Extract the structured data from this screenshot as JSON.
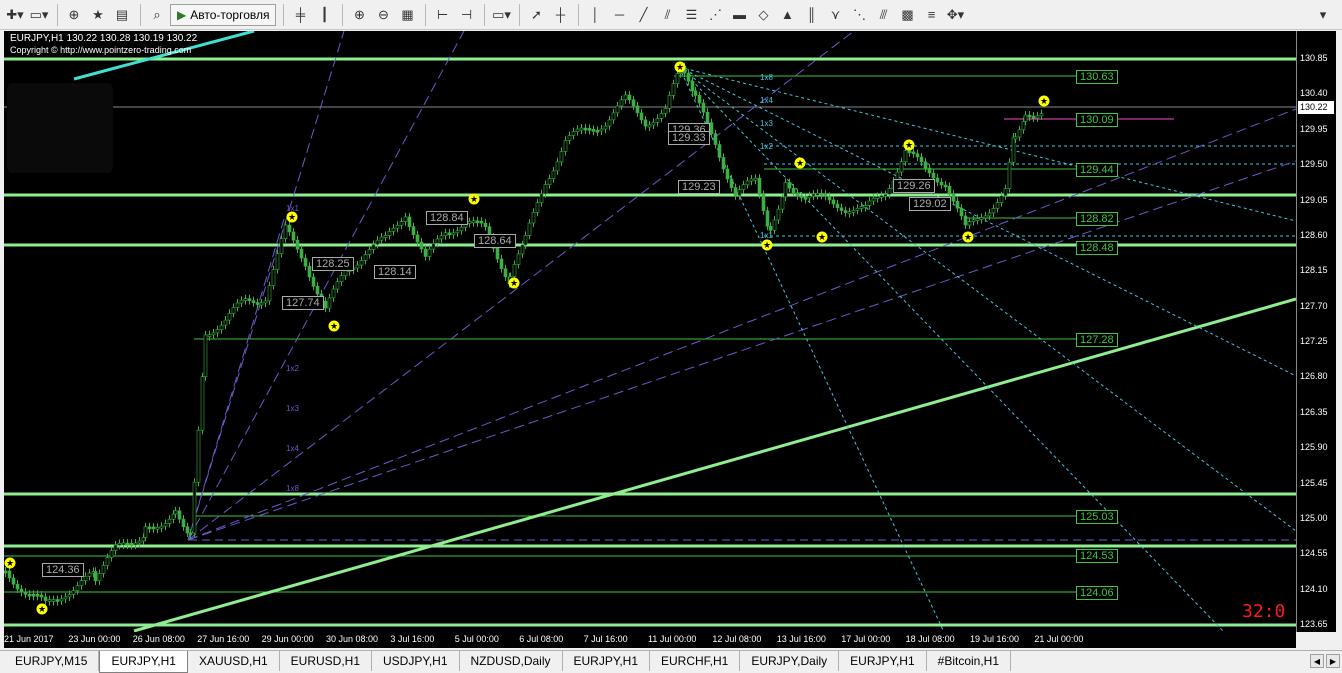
{
  "toolbar": {
    "autotrade_label": "Авто-торговля",
    "icons": [
      "new-chart-icon",
      "profiles-icon",
      "market-watch-icon",
      "navigator-icon",
      "terminal-icon",
      "strategy-tester-icon",
      "autotrade-icon",
      "bar-chart-icon",
      "candles-icon",
      "line-chart-icon",
      "zoom-in-icon",
      "zoom-out-icon",
      "tile-windows-icon",
      "chart-shift-icon",
      "autoscroll-icon",
      "period-icon",
      "cursor-icon",
      "crosshair-icon",
      "vertical-line-icon",
      "horizontal-line-icon",
      "trendline-icon",
      "equidistant-channel-icon",
      "fibonacci-icon",
      "fibonacci-fan-icon",
      "rectangle-icon",
      "gann-fan-icon",
      "triangle-icon",
      "fibonacci-timezones-icon",
      "andrews-pitchfork-icon",
      "gann-grid-icon",
      "channel-icon",
      "gann-line-icon",
      "arrows-icon"
    ]
  },
  "chart": {
    "symbol_line": "EURJPY,H1  130.22 130.28 130.19 130.22",
    "copyright": "Copyright © http://www.pointzero-trading.com",
    "countdown": "32:0",
    "current_price": "130.22",
    "price_labels": [
      "130.85",
      "130.40",
      "129.95",
      "129.50",
      "129.05",
      "128.60",
      "128.15",
      "127.70",
      "127.25",
      "126.80",
      "126.35",
      "125.90",
      "125.45",
      "125.00",
      "124.55",
      "124.10",
      "123.65"
    ],
    "time_labels": [
      "21 Jun 2017",
      "23 Jun 00:00",
      "26 Jun 08:00",
      "27 Jun 16:00",
      "29 Jun 00:00",
      "30 Jun 08:00",
      "3 Jul 16:00",
      "5 Jul 00:00",
      "6 Jul 08:00",
      "7 Jul 16:00",
      "11 Jul 00:00",
      "12 Jul 08:00",
      "13 Jul 16:00",
      "17 Jul 00:00",
      "18 Jul 08:00",
      "19 Jul 16:00",
      "21 Jul 00:00"
    ],
    "green_levels": [
      "130.63",
      "130.09",
      "129.44",
      "128.82",
      "128.48",
      "127.28",
      "125.03",
      "124.53",
      "124.06"
    ],
    "white_labels": [
      "124.36",
      "127.74",
      "128.25",
      "128.14",
      "128.84",
      "128.64",
      "129.23",
      "129.36",
      "129.33",
      "129.02",
      "129.26"
    ],
    "gann_ratios_left": [
      "1x1",
      "1x2",
      "1x3",
      "1x4",
      "1x8"
    ],
    "gann_ratios_right": [
      "1x8",
      "1x4",
      "1x3",
      "1x2",
      "1x1"
    ],
    "colors": {
      "background": "#000000",
      "level": "#3ec43e",
      "bright_level": "#90ee90",
      "fan_left": "#6a5acd",
      "fan_right": "#40c8e0",
      "candle": "#3cb043",
      "star": "#ffff00",
      "countdown": "#ff1a1a"
    }
  },
  "tabs": [
    {
      "label": "EURJPY,M15",
      "active": false
    },
    {
      "label": "EURJPY,H1",
      "active": true
    },
    {
      "label": "XAUUSD,H1",
      "active": false
    },
    {
      "label": "EURUSD,H1",
      "active": false
    },
    {
      "label": "USDJPY,H1",
      "active": false
    },
    {
      "label": "NZDUSD,Daily",
      "active": false
    },
    {
      "label": "EURJPY,H1",
      "active": false
    },
    {
      "label": "EURCHF,H1",
      "active": false
    },
    {
      "label": "EURJPY,Daily",
      "active": false
    },
    {
      "label": "EURJPY,H1",
      "active": false
    },
    {
      "label": "#Bitcoin,H1",
      "active": false
    }
  ]
}
